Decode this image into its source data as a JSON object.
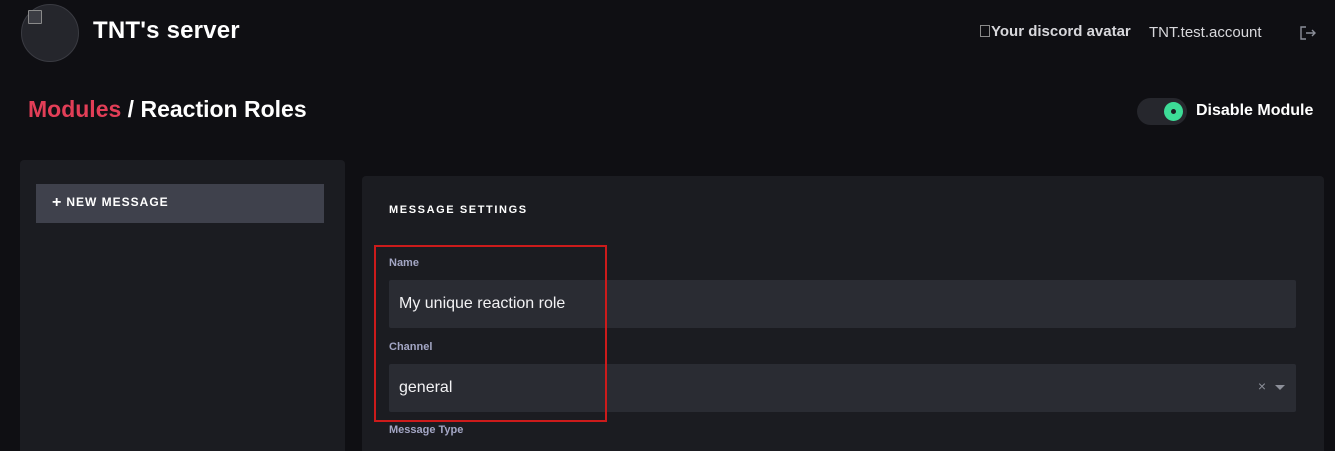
{
  "header": {
    "server_name": "TNT's server",
    "avatar_alt": "Your discord avatar",
    "username": "TNT.test.account",
    "logout_icon": "logout-icon"
  },
  "title": {
    "module_link": "Modules",
    "separator": " / ",
    "page": "Reaction Roles"
  },
  "module_toggle": {
    "label": "Disable Module",
    "enabled": true,
    "color": "#3ddc97"
  },
  "sidebar": {
    "new_message_label": "NEW MESSAGE",
    "new_message_icon": "+"
  },
  "settings": {
    "heading": "MESSAGE SETTINGS",
    "name_label": "Name",
    "name_value": "My unique reaction role",
    "channel_label": "Channel",
    "channel_value": "general",
    "clear_glyph": "×",
    "message_type_label": "Message Type"
  },
  "colors": {
    "accent": "#e23e57",
    "background": "#0f0f13",
    "panel": "#1b1c21",
    "input": "#2a2c33",
    "label": "#a3a6c4",
    "highlight": "#cc1b1b"
  }
}
